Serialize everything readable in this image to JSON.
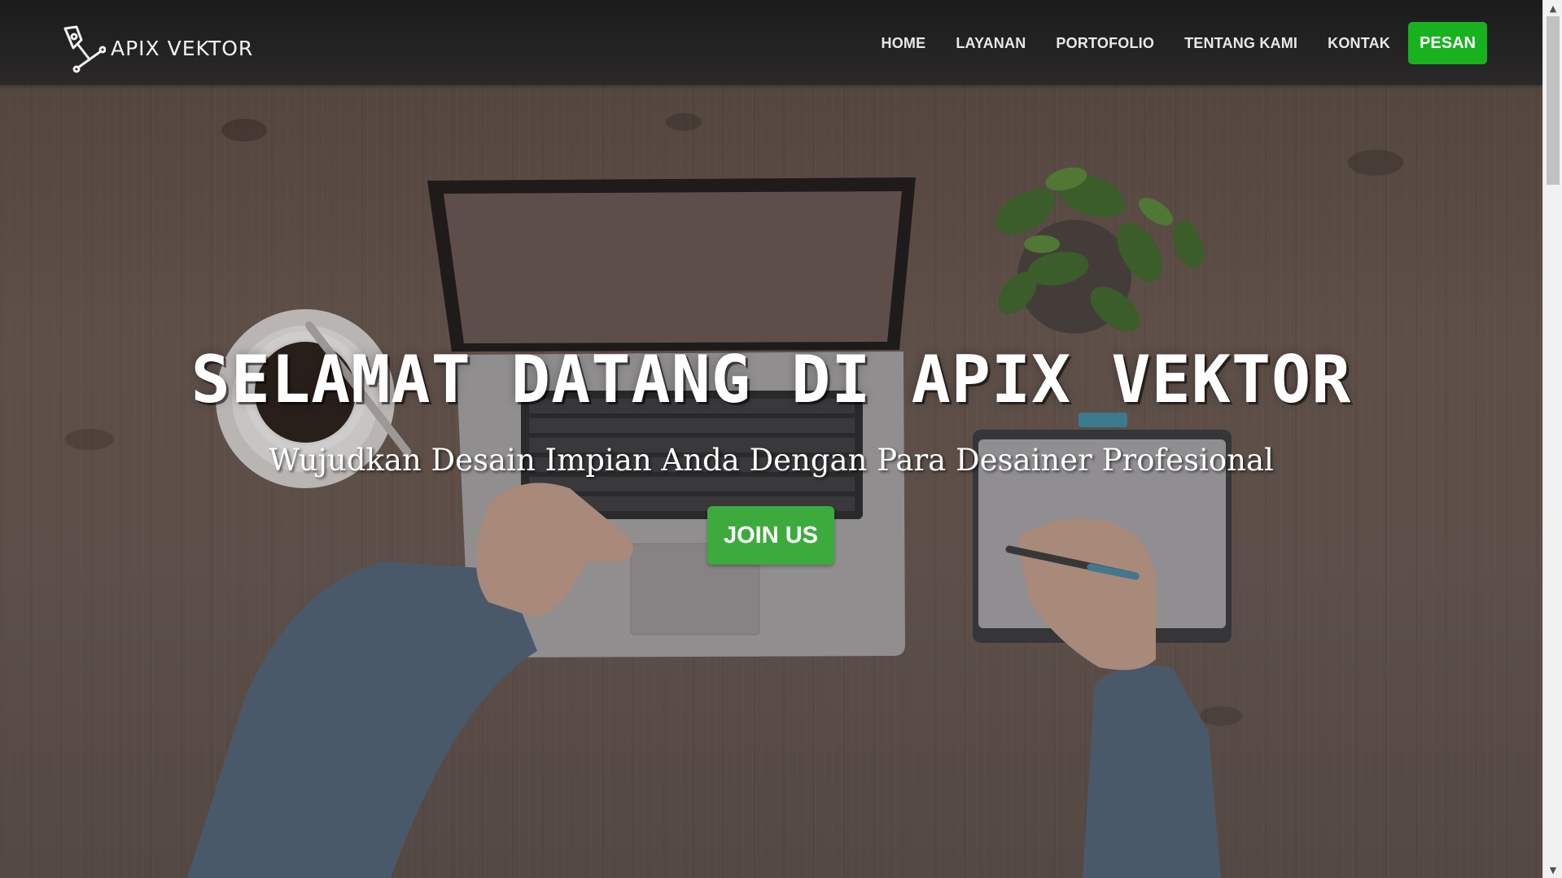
{
  "brand": {
    "name": "APIX VEKTOR",
    "icon": "pen-tool-icon"
  },
  "nav": {
    "items": [
      {
        "label": "HOME"
      },
      {
        "label": "LAYANAN"
      },
      {
        "label": "PORTOFOLIO"
      },
      {
        "label": "TENTANG KAMI"
      },
      {
        "label": "KONTAK"
      }
    ],
    "cta_label": "PESAN"
  },
  "hero": {
    "title": "SELAMAT DATANG DI APIX VEKTOR",
    "subtitle": "Wujudkan Desain Impian Anda Dengan Para Desainer Profesional",
    "button_label": "JOIN US"
  },
  "colors": {
    "accent_green": "#18b21f",
    "join_green": "#3daa3e",
    "navbar_bg": "#1f1e1f"
  },
  "scrollbar": {
    "up_icon": "scroll-up-arrow-icon",
    "down_icon": "scroll-down-arrow-icon"
  }
}
